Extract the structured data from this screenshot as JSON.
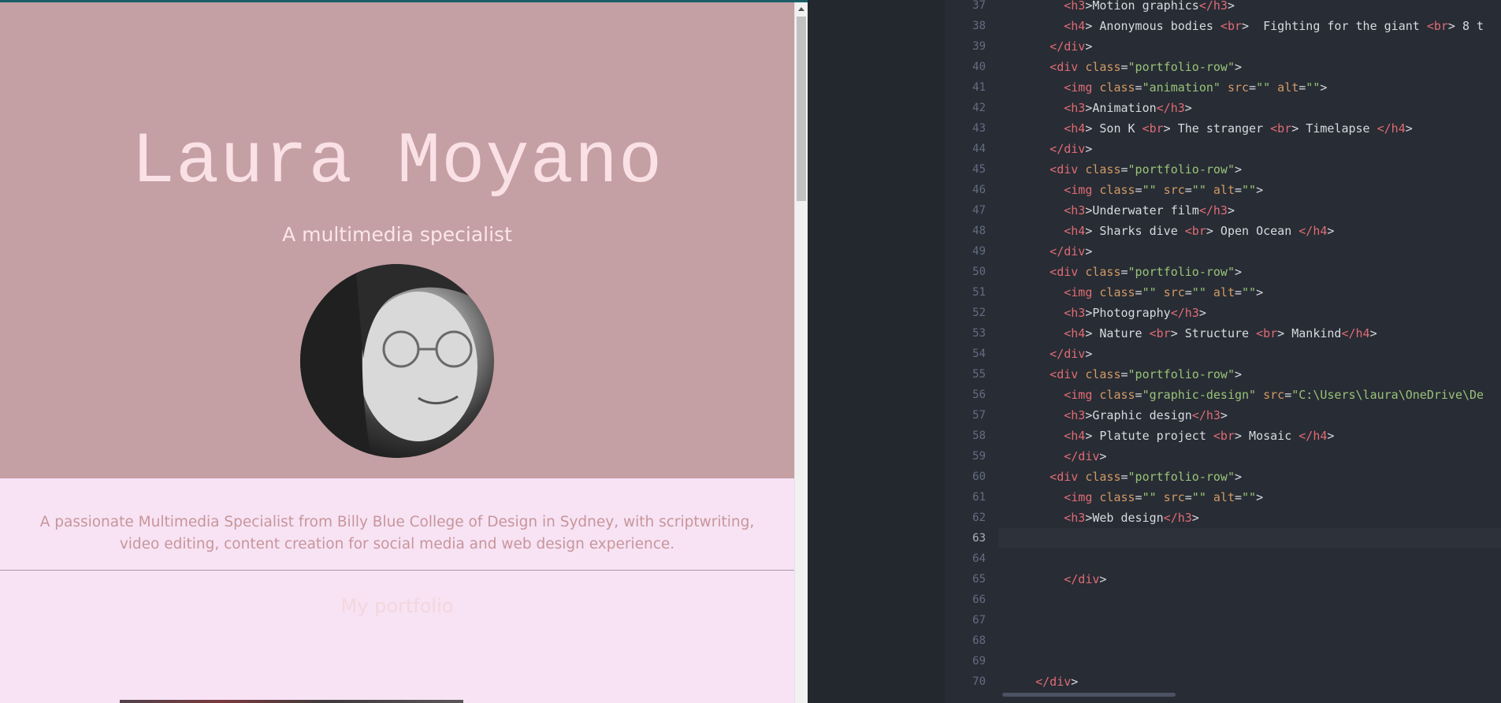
{
  "preview": {
    "hero_title": "Laura Moyano",
    "hero_subtitle": "A multimedia specialist",
    "bio_line1": "A passionate Multimedia Specialist from Billy Blue College of Design in Sydney, with scriptwriting,",
    "bio_line2": "video editing, content creation for social media and web design experience.",
    "portfolio_heading": "My portfolio",
    "colors": {
      "hero_bg": "#c49fa3",
      "page_bg": "#f7e3f4",
      "hero_text": "#f9e1e6",
      "bio_text": "#c8959b"
    }
  },
  "editor": {
    "active_line": 63,
    "lines": [
      {
        "n": 37,
        "indent": 8,
        "tokens": [
          [
            "t",
            "<h3"
          ],
          [
            "p",
            ">"
          ],
          [
            "x",
            "Motion graphics"
          ],
          [
            "t",
            "</h3"
          ],
          [
            "p",
            ">"
          ]
        ]
      },
      {
        "n": 38,
        "indent": 8,
        "tokens": [
          [
            "t",
            "<h4"
          ],
          [
            "p",
            "> "
          ],
          [
            "x",
            "Anonymous bodies "
          ],
          [
            "t",
            "<br"
          ],
          [
            "p",
            ">"
          ],
          [
            "x",
            "  Fighting for the giant "
          ],
          [
            "t",
            "<br"
          ],
          [
            "p",
            ">"
          ],
          [
            "x",
            " 8 t"
          ]
        ]
      },
      {
        "n": 39,
        "indent": 6,
        "tokens": [
          [
            "t",
            "</div"
          ],
          [
            "p",
            ">"
          ]
        ]
      },
      {
        "n": 40,
        "indent": 6,
        "tokens": [
          [
            "t",
            "<div "
          ],
          [
            "a",
            "class"
          ],
          [
            "p",
            "="
          ],
          [
            "s",
            "\"portfolio-row\""
          ],
          [
            "p",
            ">"
          ]
        ]
      },
      {
        "n": 41,
        "indent": 8,
        "tokens": [
          [
            "t",
            "<img "
          ],
          [
            "a",
            "class"
          ],
          [
            "p",
            "="
          ],
          [
            "s",
            "\"animation\""
          ],
          [
            "p",
            " "
          ],
          [
            "a",
            "src"
          ],
          [
            "p",
            "="
          ],
          [
            "s",
            "\"\""
          ],
          [
            "p",
            " "
          ],
          [
            "a",
            "alt"
          ],
          [
            "p",
            "="
          ],
          [
            "s",
            "\"\""
          ],
          [
            "p",
            ">"
          ]
        ]
      },
      {
        "n": 42,
        "indent": 8,
        "tokens": [
          [
            "t",
            "<h3"
          ],
          [
            "p",
            ">"
          ],
          [
            "x",
            "Animation"
          ],
          [
            "t",
            "</h3"
          ],
          [
            "p",
            ">"
          ]
        ]
      },
      {
        "n": 43,
        "indent": 8,
        "tokens": [
          [
            "t",
            "<h4"
          ],
          [
            "p",
            "> "
          ],
          [
            "x",
            "Son K "
          ],
          [
            "t",
            "<br"
          ],
          [
            "p",
            "> "
          ],
          [
            "x",
            "The stranger "
          ],
          [
            "t",
            "<br"
          ],
          [
            "p",
            "> "
          ],
          [
            "x",
            "Timelapse "
          ],
          [
            "t",
            "</h4"
          ],
          [
            "p",
            ">"
          ]
        ]
      },
      {
        "n": 44,
        "indent": 6,
        "tokens": [
          [
            "t",
            "</div"
          ],
          [
            "p",
            ">"
          ]
        ]
      },
      {
        "n": 45,
        "indent": 6,
        "tokens": [
          [
            "t",
            "<div "
          ],
          [
            "a",
            "class"
          ],
          [
            "p",
            "="
          ],
          [
            "s",
            "\"portfolio-row\""
          ],
          [
            "p",
            ">"
          ]
        ]
      },
      {
        "n": 46,
        "indent": 8,
        "tokens": [
          [
            "t",
            "<img "
          ],
          [
            "a",
            "class"
          ],
          [
            "p",
            "="
          ],
          [
            "s",
            "\"\""
          ],
          [
            "p",
            " "
          ],
          [
            "a",
            "src"
          ],
          [
            "p",
            "="
          ],
          [
            "s",
            "\"\""
          ],
          [
            "p",
            " "
          ],
          [
            "a",
            "alt"
          ],
          [
            "p",
            "="
          ],
          [
            "s",
            "\"\""
          ],
          [
            "p",
            ">"
          ]
        ]
      },
      {
        "n": 47,
        "indent": 8,
        "tokens": [
          [
            "t",
            "<h3"
          ],
          [
            "p",
            ">"
          ],
          [
            "x",
            "Underwater film"
          ],
          [
            "t",
            "</h3"
          ],
          [
            "p",
            ">"
          ]
        ]
      },
      {
        "n": 48,
        "indent": 8,
        "tokens": [
          [
            "t",
            "<h4"
          ],
          [
            "p",
            "> "
          ],
          [
            "x",
            "Sharks dive "
          ],
          [
            "t",
            "<br"
          ],
          [
            "p",
            "> "
          ],
          [
            "x",
            "Open Ocean "
          ],
          [
            "t",
            "</h4"
          ],
          [
            "p",
            ">"
          ]
        ]
      },
      {
        "n": 49,
        "indent": 6,
        "tokens": [
          [
            "t",
            "</div"
          ],
          [
            "p",
            ">"
          ]
        ]
      },
      {
        "n": 50,
        "indent": 6,
        "tokens": [
          [
            "t",
            "<div "
          ],
          [
            "a",
            "class"
          ],
          [
            "p",
            "="
          ],
          [
            "s",
            "\"portfolio-row\""
          ],
          [
            "p",
            ">"
          ]
        ]
      },
      {
        "n": 51,
        "indent": 8,
        "tokens": [
          [
            "t",
            "<img "
          ],
          [
            "a",
            "class"
          ],
          [
            "p",
            "="
          ],
          [
            "s",
            "\"\""
          ],
          [
            "p",
            " "
          ],
          [
            "a",
            "src"
          ],
          [
            "p",
            "="
          ],
          [
            "s",
            "\"\""
          ],
          [
            "p",
            " "
          ],
          [
            "a",
            "alt"
          ],
          [
            "p",
            "="
          ],
          [
            "s",
            "\"\""
          ],
          [
            "p",
            ">"
          ]
        ]
      },
      {
        "n": 52,
        "indent": 8,
        "tokens": [
          [
            "t",
            "<h3"
          ],
          [
            "p",
            ">"
          ],
          [
            "x",
            "Photography"
          ],
          [
            "t",
            "</h3"
          ],
          [
            "p",
            ">"
          ]
        ]
      },
      {
        "n": 53,
        "indent": 8,
        "tokens": [
          [
            "t",
            "<h4"
          ],
          [
            "p",
            "> "
          ],
          [
            "x",
            "Nature "
          ],
          [
            "t",
            "<br"
          ],
          [
            "p",
            "> "
          ],
          [
            "x",
            "Structure "
          ],
          [
            "t",
            "<br"
          ],
          [
            "p",
            "> "
          ],
          [
            "x",
            "Mankind"
          ],
          [
            "t",
            "</h4"
          ],
          [
            "p",
            ">"
          ]
        ]
      },
      {
        "n": 54,
        "indent": 6,
        "tokens": [
          [
            "t",
            "</div"
          ],
          [
            "p",
            ">"
          ]
        ]
      },
      {
        "n": 55,
        "indent": 6,
        "tokens": [
          [
            "t",
            "<div "
          ],
          [
            "a",
            "class"
          ],
          [
            "p",
            "="
          ],
          [
            "s",
            "\"portfolio-row\""
          ],
          [
            "p",
            ">"
          ]
        ]
      },
      {
        "n": 56,
        "indent": 8,
        "tokens": [
          [
            "t",
            "<img "
          ],
          [
            "a",
            "class"
          ],
          [
            "p",
            "="
          ],
          [
            "s",
            "\"graphic-design\""
          ],
          [
            "p",
            " "
          ],
          [
            "a",
            "src"
          ],
          [
            "p",
            "="
          ],
          [
            "s",
            "\"C:\\Users\\laura\\OneDrive\\De"
          ]
        ]
      },
      {
        "n": 57,
        "indent": 8,
        "tokens": [
          [
            "t",
            "<h3"
          ],
          [
            "p",
            ">"
          ],
          [
            "x",
            "Graphic design"
          ],
          [
            "t",
            "</h3"
          ],
          [
            "p",
            ">"
          ]
        ]
      },
      {
        "n": 58,
        "indent": 8,
        "tokens": [
          [
            "t",
            "<h4"
          ],
          [
            "p",
            "> "
          ],
          [
            "x",
            "Platute project "
          ],
          [
            "t",
            "<br"
          ],
          [
            "p",
            "> "
          ],
          [
            "x",
            "Mosaic "
          ],
          [
            "t",
            "</h4"
          ],
          [
            "p",
            ">"
          ]
        ]
      },
      {
        "n": 59,
        "indent": 8,
        "tokens": [
          [
            "t",
            "</div"
          ],
          [
            "p",
            ">"
          ]
        ]
      },
      {
        "n": 60,
        "indent": 6,
        "tokens": [
          [
            "t",
            "<div "
          ],
          [
            "a",
            "class"
          ],
          [
            "p",
            "="
          ],
          [
            "s",
            "\"portfolio-row\""
          ],
          [
            "p",
            ">"
          ]
        ]
      },
      {
        "n": 61,
        "indent": 8,
        "tokens": [
          [
            "t",
            "<img "
          ],
          [
            "a",
            "class"
          ],
          [
            "p",
            "="
          ],
          [
            "s",
            "\"\""
          ],
          [
            "p",
            " "
          ],
          [
            "a",
            "src"
          ],
          [
            "p",
            "="
          ],
          [
            "s",
            "\"\""
          ],
          [
            "p",
            " "
          ],
          [
            "a",
            "alt"
          ],
          [
            "p",
            "="
          ],
          [
            "s",
            "\"\""
          ],
          [
            "p",
            ">"
          ]
        ]
      },
      {
        "n": 62,
        "indent": 8,
        "tokens": [
          [
            "t",
            "<h3"
          ],
          [
            "p",
            ">"
          ],
          [
            "x",
            "Web design"
          ],
          [
            "t",
            "</h3"
          ],
          [
            "p",
            ">"
          ]
        ]
      },
      {
        "n": 63,
        "indent": 0,
        "tokens": []
      },
      {
        "n": 64,
        "indent": 0,
        "tokens": []
      },
      {
        "n": 65,
        "indent": 8,
        "tokens": [
          [
            "t",
            "</div"
          ],
          [
            "p",
            ">"
          ]
        ]
      },
      {
        "n": 66,
        "indent": 0,
        "tokens": []
      },
      {
        "n": 67,
        "indent": 0,
        "tokens": []
      },
      {
        "n": 68,
        "indent": 0,
        "tokens": []
      },
      {
        "n": 69,
        "indent": 0,
        "tokens": []
      },
      {
        "n": 70,
        "indent": 4,
        "tokens": [
          [
            "t",
            "</div"
          ],
          [
            "p",
            ">"
          ]
        ]
      }
    ],
    "colors": {
      "tag": "#e06c75",
      "attribute": "#d19a66",
      "string": "#98c379",
      "text": "#d7dae0",
      "line_number": "#636d83",
      "background": "#282c34"
    }
  }
}
